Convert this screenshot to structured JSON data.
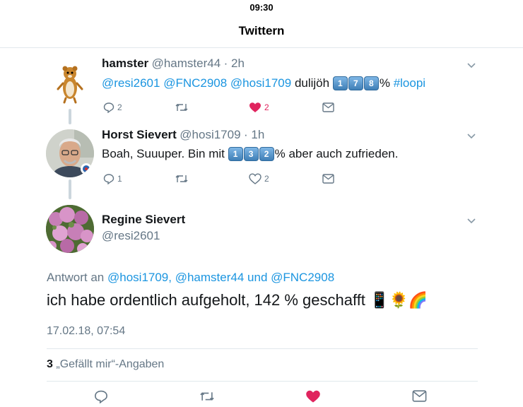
{
  "status_bar": {
    "time": "09:30"
  },
  "nav": {
    "title": "Twittern"
  },
  "tweets": [
    {
      "name": "hamster",
      "handle": "@hamster44",
      "time": "· 2h",
      "mentions": "@resi2601 @FNC2908 @hosi1709",
      "text_word": "dulijöh",
      "keycaps": [
        "1",
        "7",
        "8"
      ],
      "text_after": "%",
      "hashtag": "#loopi",
      "reply_count": "2",
      "like_count": "2",
      "liked": true
    },
    {
      "name": "Horst Sievert",
      "handle": "@hosi1709",
      "time": "· 1h",
      "text_before": "Boah, Suuuper. Bin mit",
      "keycaps": [
        "1",
        "3",
        "2"
      ],
      "text_after": "% aber auch zufrieden.",
      "reply_count": "1",
      "like_count": "2",
      "liked": false
    }
  ],
  "main_tweet": {
    "name": "Regine Sievert",
    "handle": "@resi2601",
    "reply_prefix": "Antwort an",
    "reply_to": "@hosi1709, @hamster44",
    "reply_and": "und",
    "reply_last": "@FNC2908",
    "text": "ich habe ordentlich aufgeholt, 142 % geschafft",
    "emoji": [
      "📱",
      "🌻",
      "🌈"
    ],
    "timestamp": "17.02.18, 07:54",
    "likes_count": "3",
    "likes_label": "„Gefällt mir“-Angaben"
  },
  "colors": {
    "link": "#1b95e0",
    "like": "#e0245e",
    "secondary": "#657786",
    "divider": "#e1e8ed"
  }
}
